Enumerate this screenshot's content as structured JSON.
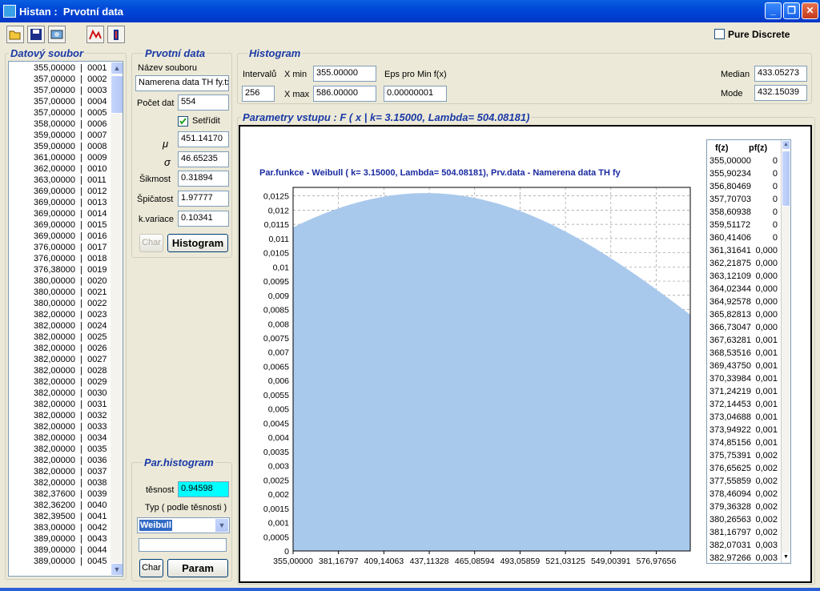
{
  "window": {
    "title": "Histan :  Prvotní data",
    "min_icon": "minimize-icon",
    "max_icon": "restore-icon",
    "close_icon": "close-icon"
  },
  "toolbar": {
    "buttons": [
      "open-folder-icon",
      "save-icon",
      "disk-icon",
      "chart-line-icon",
      "column-icon"
    ],
    "pure_discrete_label": "Pure Discrete",
    "pure_discrete_checked": false
  },
  "datovy_soubor": {
    "title": "Datový soubor",
    "rows": [
      "355,00000  |  0001",
      "357,00000  |  0002",
      "357,00000  |  0003",
      "357,00000  |  0004",
      "357,00000  |  0005",
      "358,00000  |  0006",
      "359,00000  |  0007",
      "359,00000  |  0008",
      "361,00000  |  0009",
      "362,00000  |  0010",
      "363,00000  |  0011",
      "369,00000  |  0012",
      "369,00000  |  0013",
      "369,00000  |  0014",
      "369,00000  |  0015",
      "369,00000  |  0016",
      "376,00000  |  0017",
      "376,00000  |  0018",
      "376,38000  |  0019",
      "380,00000  |  0020",
      "380,00000  |  0021",
      "380,00000  |  0022",
      "382,00000  |  0023",
      "382,00000  |  0024",
      "382,00000  |  0025",
      "382,00000  |  0026",
      "382,00000  |  0027",
      "382,00000  |  0028",
      "382,00000  |  0029",
      "382,00000  |  0030",
      "382,00000  |  0031",
      "382,00000  |  0032",
      "382,00000  |  0033",
      "382,00000  |  0034",
      "382,00000  |  0035",
      "382,00000  |  0036",
      "382,00000  |  0037",
      "382,00000  |  0038",
      "382,37600  |  0039",
      "382,36200  |  0040",
      "382,39500  |  0041",
      "383,00000  |  0042",
      "389,00000  |  0043",
      "389,00000  |  0044",
      "389,00000  |  0045"
    ]
  },
  "prvotni": {
    "title": "Prvotní data",
    "nazev_label": "Název souboru",
    "nazev_value": "Namerena data TH fy.txt",
    "pocet_label": "Počet dat",
    "pocet_value": "554",
    "setridit_label": "Setřídit",
    "setridit_checked": true,
    "mu_label": "μ",
    "mu_value": "451.14170",
    "sigma_label": "σ",
    "sigma_value": "46.65235",
    "sikmost_label": "Šikmost",
    "sikmost_value": "0.31894",
    "spicatost_label": "Špičatost",
    "spicatost_value": "1.97777",
    "kvar_label": "k.variace",
    "kvar_value": "0.10341",
    "char_button": "Char",
    "histogram_button": "Histogram"
  },
  "histogram": {
    "title": "Histogram",
    "intervalu_label": "Intervalů",
    "intervalu_value": "256",
    "xmin_label": "X min",
    "xmin_value": "355.00000",
    "xmax_label": "X max",
    "xmax_value": "586.00000",
    "eps_label": "Eps pro Min f(x)",
    "eps_value": "0.00000001",
    "median_label": "Median",
    "median_value": "433.05273",
    "mode_label": "Mode",
    "mode_value": "432.15039"
  },
  "par_histogram": {
    "title": "Par.histogram",
    "tesnost_label": "těsnost",
    "tesnost_value": "0.94598",
    "typ_label": "Typ ( podle těsnosti )",
    "typ_value": "Weibull",
    "extra_value": "",
    "char_button": "Char",
    "param_button": "Param",
    "highlight": "#00ffff"
  },
  "params": {
    "title": "Parametry vstupu : F ( x | k= 3.15000, Lambda= 504.08181)"
  },
  "chart_data": {
    "type": "area",
    "title": "Par.funkce - Weibull ( k= 3.15000, Lambda= 504.08181), Prv.data - Namerena data TH fy",
    "distribution": {
      "name": "Weibull",
      "k": 3.15,
      "lambda": 504.08181,
      "x_min": 355,
      "x_max": 586,
      "intervals": 256
    },
    "peak": {
      "x": 432.15,
      "y": 0.0126
    },
    "xlim": [
      355,
      586
    ],
    "ylim": [
      0,
      0.0128
    ],
    "xticks": [
      "355,00000",
      "381,16797",
      "409,14063",
      "437,11328",
      "465,08594",
      "493,05859",
      "521,03125",
      "549,00391",
      "576,97656"
    ],
    "yticks": [
      "0",
      "0,0005",
      "0,001",
      "0,0015",
      "0,002",
      "0,0025",
      "0,003",
      "0,0035",
      "0,004",
      "0,0045",
      "0,005",
      "0,0055",
      "0,006",
      "0,0065",
      "0,007",
      "0,0075",
      "0,008",
      "0,0085",
      "0,009",
      "0,0095",
      "0,01",
      "0,0105",
      "0,011",
      "0,0115",
      "0,012",
      "0,0125"
    ],
    "fill": "#a9c9ec",
    "grid": true
  },
  "fz_table": {
    "header_fz": "f(z)",
    "header_pfz": "pf(z)",
    "rows": [
      [
        "355,00000",
        "0"
      ],
      [
        "355,90234",
        "0"
      ],
      [
        "356,80469",
        "0"
      ],
      [
        "357,70703",
        "0"
      ],
      [
        "358,60938",
        "0"
      ],
      [
        "359,51172",
        "0"
      ],
      [
        "360,41406",
        "0"
      ],
      [
        "361,31641",
        "0,000"
      ],
      [
        "362,21875",
        "0,000"
      ],
      [
        "363,12109",
        "0,000"
      ],
      [
        "364,02344",
        "0,000"
      ],
      [
        "364,92578",
        "0,000"
      ],
      [
        "365,82813",
        "0,000"
      ],
      [
        "366,73047",
        "0,000"
      ],
      [
        "367,63281",
        "0,001"
      ],
      [
        "368,53516",
        "0,001"
      ],
      [
        "369,43750",
        "0,001"
      ],
      [
        "370,33984",
        "0,001"
      ],
      [
        "371,24219",
        "0,001"
      ],
      [
        "372,14453",
        "0,001"
      ],
      [
        "373,04688",
        "0,001"
      ],
      [
        "373,94922",
        "0,001"
      ],
      [
        "374,85156",
        "0,001"
      ],
      [
        "375,75391",
        "0,002"
      ],
      [
        "376,65625",
        "0,002"
      ],
      [
        "377,55859",
        "0,002"
      ],
      [
        "378,46094",
        "0,002"
      ],
      [
        "379,36328",
        "0,002"
      ],
      [
        "380,26563",
        "0,002"
      ],
      [
        "381,16797",
        "0,002"
      ],
      [
        "382,07031",
        "0,003"
      ],
      [
        "382,97266",
        "0,003"
      ]
    ]
  }
}
